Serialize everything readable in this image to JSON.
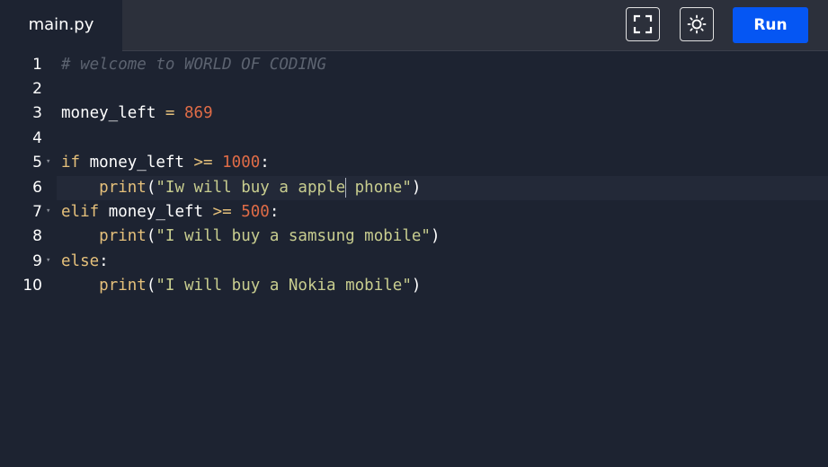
{
  "tab": {
    "filename": "main.py"
  },
  "toolbar": {
    "fullscreen_icon": "fullscreen-icon",
    "theme_icon": "sun-icon",
    "run_label": "Run",
    "accent": "#0556f3"
  },
  "editor": {
    "active_line": 6,
    "lines": [
      {
        "number": "1",
        "foldable": false,
        "tokens": [
          {
            "t": "cm",
            "v": "# welcome to WORLD OF CODING"
          }
        ]
      },
      {
        "number": "2",
        "foldable": false,
        "tokens": []
      },
      {
        "number": "3",
        "foldable": false,
        "tokens": [
          {
            "t": "pl",
            "v": "money_left "
          },
          {
            "t": "op",
            "v": "="
          },
          {
            "t": "pl",
            "v": " "
          },
          {
            "t": "num",
            "v": "869"
          }
        ]
      },
      {
        "number": "4",
        "foldable": false,
        "tokens": []
      },
      {
        "number": "5",
        "foldable": true,
        "tokens": [
          {
            "t": "kw",
            "v": "if"
          },
          {
            "t": "pl",
            "v": " money_left "
          },
          {
            "t": "op",
            "v": ">="
          },
          {
            "t": "pl",
            "v": " "
          },
          {
            "t": "num",
            "v": "1000"
          },
          {
            "t": "pl",
            "v": ":"
          }
        ]
      },
      {
        "number": "6",
        "foldable": false,
        "tokens": [
          {
            "t": "pl",
            "v": "    "
          },
          {
            "t": "fn",
            "v": "print"
          },
          {
            "t": "pl",
            "v": "("
          },
          {
            "t": "str",
            "v": "\"Iw will buy a apple"
          },
          {
            "t": "cursor",
            "v": ""
          },
          {
            "t": "str",
            "v": " phone\""
          },
          {
            "t": "pl",
            "v": ")"
          }
        ]
      },
      {
        "number": "7",
        "foldable": true,
        "tokens": [
          {
            "t": "kw",
            "v": "elif"
          },
          {
            "t": "pl",
            "v": " money_left "
          },
          {
            "t": "op",
            "v": ">="
          },
          {
            "t": "pl",
            "v": " "
          },
          {
            "t": "num",
            "v": "500"
          },
          {
            "t": "pl",
            "v": ":"
          }
        ]
      },
      {
        "number": "8",
        "foldable": false,
        "tokens": [
          {
            "t": "pl",
            "v": "    "
          },
          {
            "t": "fn",
            "v": "print"
          },
          {
            "t": "pl",
            "v": "("
          },
          {
            "t": "str",
            "v": "\"I will buy a samsung mobile\""
          },
          {
            "t": "pl",
            "v": ")"
          }
        ]
      },
      {
        "number": "9",
        "foldable": true,
        "tokens": [
          {
            "t": "kw",
            "v": "else"
          },
          {
            "t": "pl",
            "v": ":"
          }
        ]
      },
      {
        "number": "10",
        "foldable": false,
        "tokens": [
          {
            "t": "pl",
            "v": "    "
          },
          {
            "t": "fn",
            "v": "print"
          },
          {
            "t": "pl",
            "v": "("
          },
          {
            "t": "str",
            "v": "\"I will buy a Nokia mobile\""
          },
          {
            "t": "pl",
            "v": ")"
          }
        ]
      }
    ]
  }
}
